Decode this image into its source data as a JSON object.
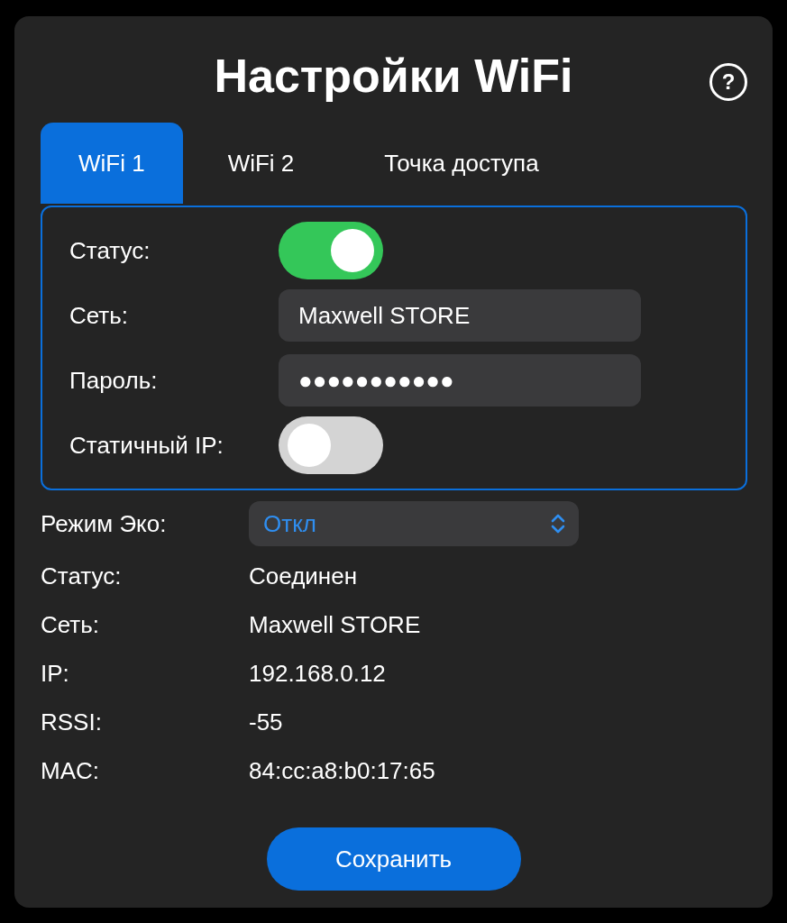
{
  "title": "Настройки WiFi",
  "help": {
    "label": "?"
  },
  "tabs": [
    {
      "label": "WiFi 1",
      "selected": true
    },
    {
      "label": "WiFi 2",
      "selected": false
    },
    {
      "label": "Точка доступа",
      "selected": false
    }
  ],
  "form": {
    "rows": [
      {
        "kind": "toggle",
        "label": "Статус:",
        "on": true
      },
      {
        "kind": "text",
        "label": "Сеть:",
        "value": "Maxwell STORE"
      },
      {
        "kind": "text",
        "label": "Пароль:",
        "value": "●●●●●●●●●●●"
      },
      {
        "kind": "toggle",
        "label": "Статичный IP:",
        "on": false
      }
    ]
  },
  "eco": {
    "label": "Режим Эко:",
    "value": "Откл"
  },
  "info": [
    {
      "label": "Статус:",
      "value": "Соединен"
    },
    {
      "label": "Сеть:",
      "value": "Maxwell STORE"
    },
    {
      "label": "IP:",
      "value": "192.168.0.12"
    },
    {
      "label": "RSSI:",
      "value": "-55"
    },
    {
      "label": "MAC:",
      "value": "84:cc:a8:b0:17:65"
    }
  ],
  "save_button": "Сохранить"
}
